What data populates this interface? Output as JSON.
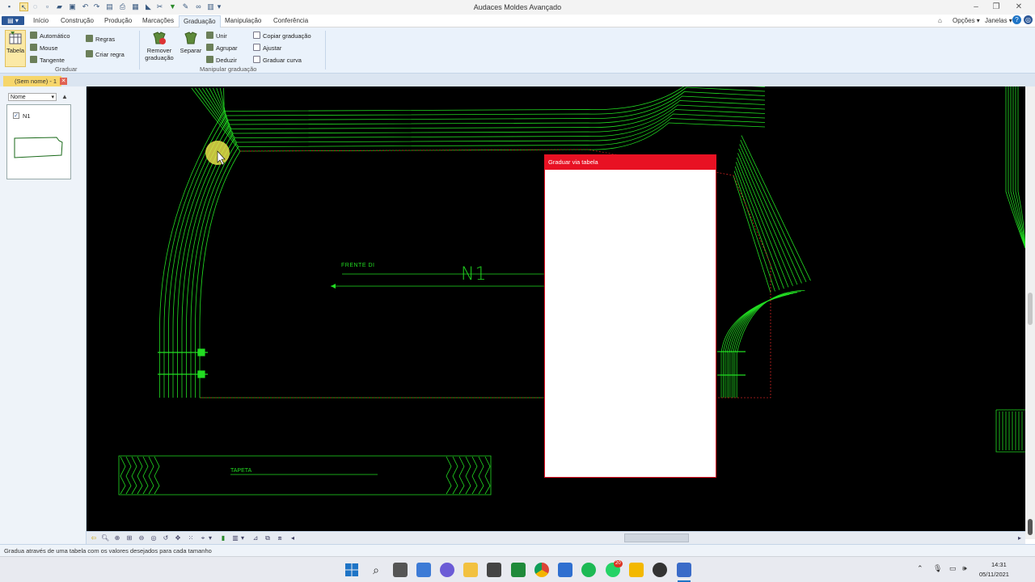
{
  "window": {
    "title": "Audaces Moldes Avançado"
  },
  "menu": {
    "app_button": "▾",
    "tabs": [
      {
        "label": "Início"
      },
      {
        "label": "Construção"
      },
      {
        "label": "Produção"
      },
      {
        "label": "Marcações"
      },
      {
        "label": "Graduação"
      },
      {
        "label": "Manipulação"
      },
      {
        "label": "Conferência"
      }
    ],
    "active_tab": "Graduação",
    "options": "Opções",
    "windows": "Janelas"
  },
  "ribbon": {
    "graduar": {
      "tabela": "Tabela",
      "automatico": "Automático",
      "mouse": "Mouse",
      "tangente": "Tangente",
      "regras": "Regras",
      "criar_regra": "Criar regra",
      "group_label": "Graduar"
    },
    "manipular": {
      "remover_line1": "Remover",
      "remover_line2": "graduação",
      "separar": "Separar",
      "unir": "Unir",
      "agrupar": "Agrupar",
      "deduzir": "Deduzir",
      "copiar": "Copiar graduação",
      "ajustar": "Ajustar",
      "graduar_curva": "Graduar curva",
      "group_label": "Manipular graduação"
    }
  },
  "document": {
    "tab_label": "(Sem nome) - 1"
  },
  "left_panel": {
    "sort_label": "Nome",
    "pieces": [
      {
        "name": "N1",
        "checked": true
      }
    ]
  },
  "canvas": {
    "piece_name": "N1",
    "label_frente": "FRENTE DI",
    "label_tapeta": "TAPETA",
    "stroke_color": "#22dd22"
  },
  "dialog": {
    "title": "Graduar via tabela"
  },
  "status": {
    "text": "Gradua através de uma tabela com os valores desejados para cada tamanho"
  },
  "taskbar": {
    "time": "14:31",
    "date": "05/11/2021",
    "notification_count": "20"
  }
}
